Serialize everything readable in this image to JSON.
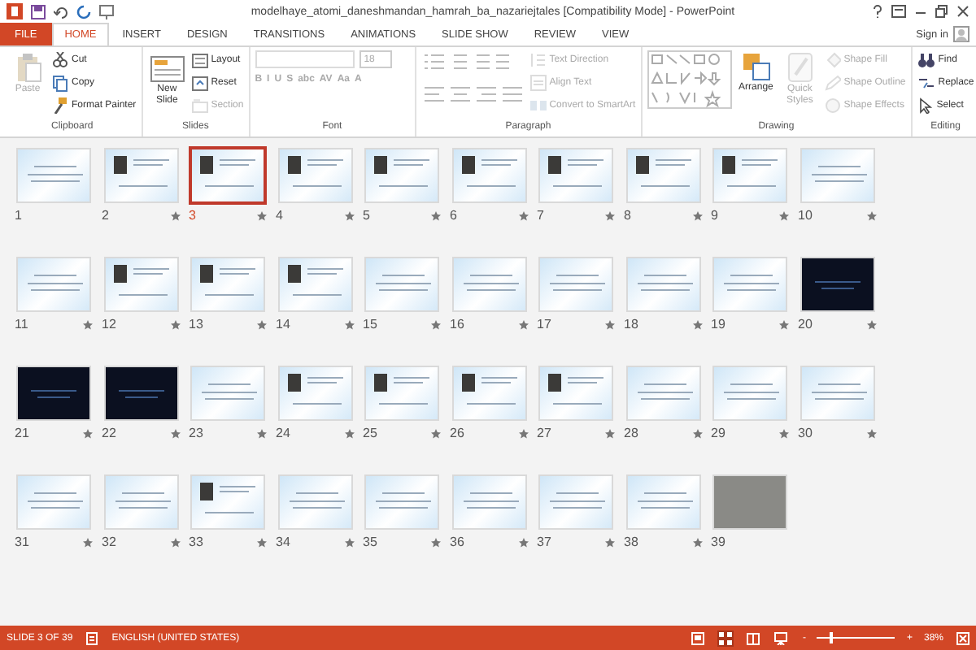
{
  "window": {
    "title": "modelhaye_atomi_daneshmandan_hamrah_ba_nazariejtales [Compatibility Mode] - PowerPoint",
    "sign_in": "Sign in"
  },
  "tabs": [
    {
      "label": "FILE",
      "kind": "file",
      "selected": false
    },
    {
      "label": "HOME",
      "kind": "tab",
      "selected": true
    },
    {
      "label": "INSERT",
      "kind": "tab",
      "selected": false
    },
    {
      "label": "DESIGN",
      "kind": "tab",
      "selected": false
    },
    {
      "label": "TRANSITIONS",
      "kind": "tab",
      "selected": false
    },
    {
      "label": "ANIMATIONS",
      "kind": "tab",
      "selected": false
    },
    {
      "label": "SLIDE SHOW",
      "kind": "tab",
      "selected": false
    },
    {
      "label": "REVIEW",
      "kind": "tab",
      "selected": false
    },
    {
      "label": "VIEW",
      "kind": "tab",
      "selected": false
    }
  ],
  "ribbon": [
    {
      "label": "Clipboard",
      "items": [
        {
          "kind": "large",
          "label": "Paste",
          "disabled": true
        },
        {
          "kind": "small",
          "label": "Cut",
          "disabled": false
        },
        {
          "kind": "small",
          "label": "Copy",
          "disabled": false
        },
        {
          "kind": "small",
          "label": "Format Painter",
          "disabled": false
        }
      ]
    },
    {
      "label": "Slides",
      "items": [
        {
          "kind": "large",
          "label": "New Slide",
          "disabled": false
        },
        {
          "kind": "small",
          "label": "Layout",
          "disabled": false
        },
        {
          "kind": "small",
          "label": "Reset",
          "disabled": false
        },
        {
          "kind": "small",
          "label": "Section",
          "disabled": true
        }
      ]
    },
    {
      "label": "Font",
      "items": [
        {
          "kind": "font",
          "size": "18",
          "tools": [
            "B",
            "I",
            "U",
            "S",
            "abc",
            "AV",
            "Aa",
            "A"
          ],
          "disabled": true
        }
      ]
    },
    {
      "label": "Paragraph",
      "items": [
        {
          "kind": "para",
          "disabled": true
        },
        {
          "kind": "small",
          "label": "Text Direction",
          "disabled": true
        },
        {
          "kind": "small",
          "label": "Align Text",
          "disabled": true
        },
        {
          "kind": "small",
          "label": "Convert to SmartArt",
          "disabled": true
        }
      ]
    },
    {
      "label": "Drawing",
      "items": [
        {
          "kind": "gallery",
          "disabled": true
        },
        {
          "kind": "large",
          "label": "Arrange",
          "disabled": false
        },
        {
          "kind": "large",
          "label": "Quick Styles",
          "disabled": true
        },
        {
          "kind": "small",
          "label": "Shape Fill",
          "disabled": true
        },
        {
          "kind": "small",
          "label": "Shape Outline",
          "disabled": true
        },
        {
          "kind": "small",
          "label": "Shape Effects",
          "disabled": true
        }
      ]
    },
    {
      "label": "Editing",
      "items": [
        {
          "kind": "small",
          "label": "Find",
          "disabled": false
        },
        {
          "kind": "small",
          "label": "Replace",
          "disabled": false
        },
        {
          "kind": "small",
          "label": "Select",
          "disabled": false
        }
      ]
    }
  ],
  "slides": [
    {
      "number": "1",
      "kind": "text",
      "transition": false,
      "selected": false
    },
    {
      "number": "2",
      "kind": "portrait",
      "transition": true,
      "selected": false
    },
    {
      "number": "3",
      "kind": "portrait",
      "transition": true,
      "selected": true
    },
    {
      "number": "4",
      "kind": "portrait",
      "transition": true,
      "selected": false
    },
    {
      "number": "5",
      "kind": "portrait",
      "transition": true,
      "selected": false
    },
    {
      "number": "6",
      "kind": "portrait",
      "transition": true,
      "selected": false
    },
    {
      "number": "7",
      "kind": "portrait",
      "transition": true,
      "selected": false
    },
    {
      "number": "8",
      "kind": "portrait",
      "transition": true,
      "selected": false
    },
    {
      "number": "9",
      "kind": "portrait",
      "transition": true,
      "selected": false
    },
    {
      "number": "10",
      "kind": "text",
      "transition": true,
      "selected": false
    },
    {
      "number": "11",
      "kind": "text",
      "transition": true,
      "selected": false
    },
    {
      "number": "12",
      "kind": "portrait",
      "transition": true,
      "selected": false
    },
    {
      "number": "13",
      "kind": "portrait",
      "transition": true,
      "selected": false
    },
    {
      "number": "14",
      "kind": "portrait",
      "transition": true,
      "selected": false
    },
    {
      "number": "15",
      "kind": "text",
      "transition": true,
      "selected": false
    },
    {
      "number": "16",
      "kind": "text",
      "transition": true,
      "selected": false
    },
    {
      "number": "17",
      "kind": "text",
      "transition": true,
      "selected": false
    },
    {
      "number": "18",
      "kind": "text",
      "transition": true,
      "selected": false
    },
    {
      "number": "19",
      "kind": "text",
      "transition": true,
      "selected": false
    },
    {
      "number": "20",
      "kind": "dark",
      "transition": true,
      "selected": false
    },
    {
      "number": "21",
      "kind": "dark",
      "transition": true,
      "selected": false
    },
    {
      "number": "22",
      "kind": "dark",
      "transition": true,
      "selected": false
    },
    {
      "number": "23",
      "kind": "text",
      "transition": true,
      "selected": false
    },
    {
      "number": "24",
      "kind": "portrait",
      "transition": true,
      "selected": false
    },
    {
      "number": "25",
      "kind": "portrait",
      "transition": true,
      "selected": false
    },
    {
      "number": "26",
      "kind": "portrait",
      "transition": true,
      "selected": false
    },
    {
      "number": "27",
      "kind": "portrait",
      "transition": true,
      "selected": false
    },
    {
      "number": "28",
      "kind": "text",
      "transition": true,
      "selected": false
    },
    {
      "number": "29",
      "kind": "text",
      "transition": true,
      "selected": false
    },
    {
      "number": "30",
      "kind": "text",
      "transition": true,
      "selected": false
    },
    {
      "number": "31",
      "kind": "text",
      "transition": true,
      "selected": false
    },
    {
      "number": "32",
      "kind": "text",
      "transition": true,
      "selected": false
    },
    {
      "number": "33",
      "kind": "portrait",
      "transition": true,
      "selected": false
    },
    {
      "number": "34",
      "kind": "text",
      "transition": true,
      "selected": false
    },
    {
      "number": "35",
      "kind": "text",
      "transition": true,
      "selected": false
    },
    {
      "number": "36",
      "kind": "text",
      "transition": true,
      "selected": false
    },
    {
      "number": "37",
      "kind": "text",
      "transition": true,
      "selected": false
    },
    {
      "number": "38",
      "kind": "text",
      "transition": true,
      "selected": false
    },
    {
      "number": "39",
      "kind": "photo",
      "transition": false,
      "selected": false
    }
  ],
  "status_bar": {
    "slide": "SLIDE 3 OF 39",
    "language": "ENGLISH (UNITED STATES)",
    "views": [
      {
        "kind": "normal",
        "selected": false
      },
      {
        "kind": "sorter",
        "selected": true
      },
      {
        "kind": "reading",
        "selected": false
      },
      {
        "kind": "show",
        "selected": false
      }
    ],
    "zoom": {
      "level": 0.16,
      "reading": "38%",
      "minus": "-",
      "plus": "+"
    }
  }
}
